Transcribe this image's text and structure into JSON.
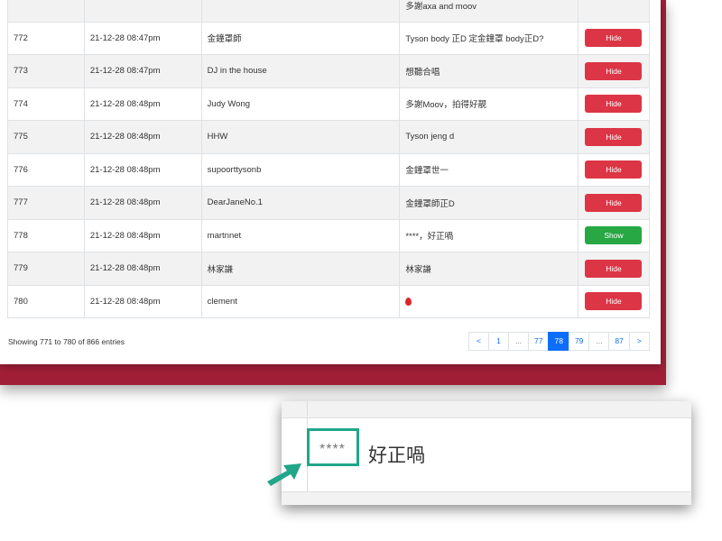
{
  "table": {
    "rows": [
      {
        "id": "",
        "time": "",
        "name": "",
        "message": "多謝axa and moov",
        "action": ""
      },
      {
        "id": "772",
        "time": "21-12-28 08:47pm",
        "name": "金鐘罩師",
        "message": "Tyson body 正D 定金鐘罩 body正D?",
        "action": "Hide"
      },
      {
        "id": "773",
        "time": "21-12-28 08:47pm",
        "name": "DJ in the house",
        "message": "想聽合唱",
        "action": "Hide"
      },
      {
        "id": "774",
        "time": "21-12-28 08:48pm",
        "name": "Judy Wong",
        "message": "多謝Moov，拍得好靚",
        "action": "Hide"
      },
      {
        "id": "775",
        "time": "21-12-28 08:48pm",
        "name": "HHW",
        "message": "Tyson jeng d",
        "action": "Hide"
      },
      {
        "id": "776",
        "time": "21-12-28 08:48pm",
        "name": "supoorttysonb",
        "message": "金鐘罩世一",
        "action": "Hide"
      },
      {
        "id": "777",
        "time": "21-12-28 08:48pm",
        "name": "DearJaneNo.1",
        "message": "金鐘罩師正D",
        "action": "Hide"
      },
      {
        "id": "778",
        "time": "21-12-28 08:48pm",
        "name": "martnnet",
        "message": "****，好正喎",
        "action": "Show"
      },
      {
        "id": "779",
        "time": "21-12-28 08:48pm",
        "name": "林家謙",
        "message": "林家謙",
        "action": "Hide"
      },
      {
        "id": "780",
        "time": "21-12-28 08:48pm",
        "name": "clement",
        "message": "",
        "message_icon": "fire-emoji-icon",
        "action": "Hide"
      }
    ]
  },
  "info": "Showing 771 to 780 of 866 entries",
  "pagination": [
    "<",
    "1",
    "...",
    "77",
    "78",
    "79",
    "...",
    "87",
    ">"
  ],
  "pagination_active": "78",
  "zoom": {
    "stars": "****",
    "message": "好正喎"
  },
  "colors": {
    "hide": "#dc3545",
    "show": "#28a745",
    "active_page": "#0d6efd",
    "backdrop": "#a01f37",
    "highlight": "#21a68a"
  }
}
